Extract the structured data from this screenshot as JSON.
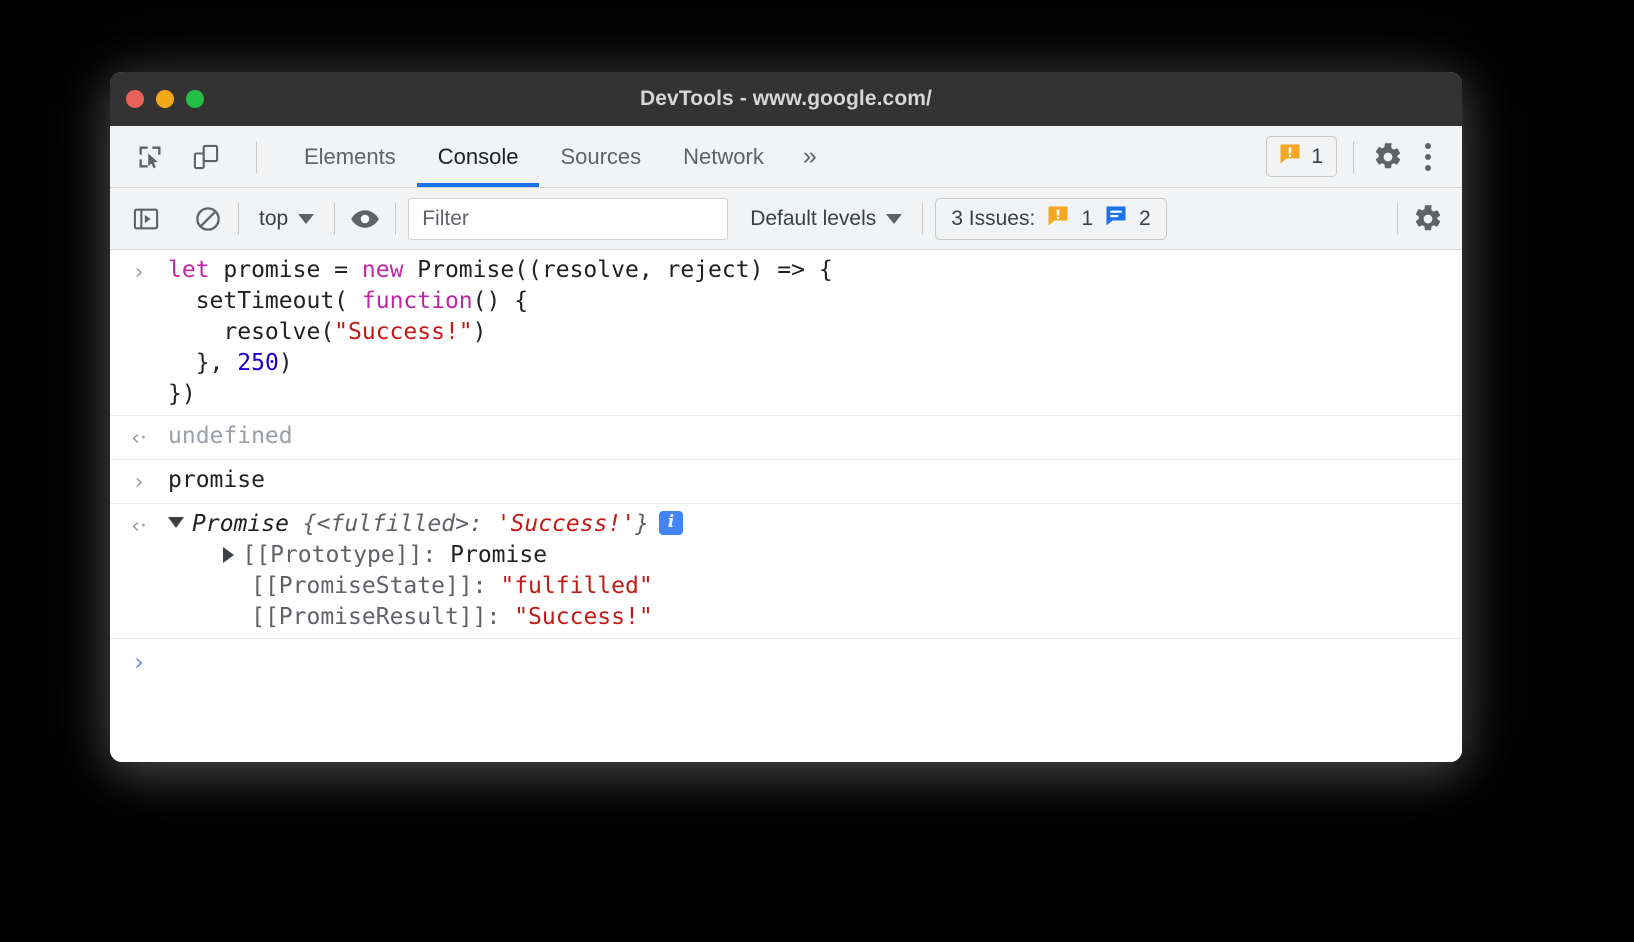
{
  "window": {
    "title": "DevTools - www.google.com/",
    "traffic_lights": [
      {
        "name": "close",
        "color": "#e8625c"
      },
      {
        "name": "minimize",
        "color": "#f3a817"
      },
      {
        "name": "zoom",
        "color": "#22bf44"
      }
    ]
  },
  "tabbar": {
    "inspect_icon": "inspect-element-icon",
    "device_icon": "device-toolbar-icon",
    "tabs": [
      {
        "label": "Elements",
        "active": false
      },
      {
        "label": "Console",
        "active": true
      },
      {
        "label": "Sources",
        "active": false
      },
      {
        "label": "Network",
        "active": false
      }
    ],
    "more_tabs_label": "»",
    "warning_badge": {
      "icon": "warning-icon",
      "count": "1"
    },
    "settings_icon": "gear-icon",
    "menu_icon": "kebab-menu-icon"
  },
  "console_toolbar": {
    "sidebar_icon": "console-sidebar-icon",
    "clear_icon": "clear-console-icon",
    "context": {
      "label": "top",
      "caret": "▼"
    },
    "eye_icon": "live-expression-icon",
    "filter": {
      "value": "",
      "placeholder": "Filter"
    },
    "levels": {
      "label": "Default levels",
      "caret": "▼"
    },
    "issues": {
      "label": "3 Issues:",
      "warning_count": "1",
      "info_count": "2"
    },
    "settings_icon": "console-settings-gear-icon"
  },
  "console": {
    "messages": [
      {
        "type": "input",
        "gutter": "›",
        "lines": [
          [
            {
              "t": "let",
              "c": "kw"
            },
            {
              "t": " promise = ",
              "c": "plain"
            },
            {
              "t": "new",
              "c": "kw"
            },
            {
              "t": " Promise((resolve, reject) => {",
              "c": "plain"
            }
          ],
          [
            {
              "t": "  setTimeout( ",
              "c": "plain"
            },
            {
              "t": "function",
              "c": "kw"
            },
            {
              "t": "() {",
              "c": "plain"
            }
          ],
          [
            {
              "t": "    resolve(",
              "c": "plain"
            },
            {
              "t": "\"Success!\"",
              "c": "str"
            },
            {
              "t": ")",
              "c": "plain"
            }
          ],
          [
            {
              "t": "  }, ",
              "c": "plain"
            },
            {
              "t": "250",
              "c": "num"
            },
            {
              "t": ")",
              "c": "plain"
            }
          ],
          [
            {
              "t": "})",
              "c": "plain"
            }
          ]
        ]
      },
      {
        "type": "output",
        "gutter": "‹·",
        "lines": [
          [
            {
              "t": "undefined",
              "c": "undef"
            }
          ]
        ]
      },
      {
        "type": "input",
        "gutter": "›",
        "lines": [
          [
            {
              "t": "promise",
              "c": "plain"
            }
          ]
        ]
      }
    ],
    "object_result": {
      "gutter": "‹·",
      "header": {
        "disclosure": "open",
        "constructor": "Promise",
        "brace_open": " {",
        "state": "<fulfilled>",
        "colon": ": ",
        "value": "'Success!'",
        "brace_close": "}",
        "info_badge": "i"
      },
      "properties": [
        {
          "disclosure": "closed",
          "key": "[[Prototype]]:",
          "value": "Promise",
          "value_kind": "plain"
        },
        {
          "disclosure": "none",
          "key": "[[PromiseState]]:",
          "value": "\"fulfilled\"",
          "value_kind": "string"
        },
        {
          "disclosure": "none",
          "key": "[[PromiseResult]]:",
          "value": "\"Success!\"",
          "value_kind": "string"
        }
      ]
    },
    "prompt": {
      "caret": "›",
      "value": ""
    }
  },
  "colors": {
    "accent": "#1a73e8",
    "warning": "#f5a623",
    "info": "#1a73e8",
    "string": "#c41a16",
    "keyword": "#c026a5",
    "number": "#1c00cf",
    "titlebar": "#333333",
    "toolbar": "#f1f3f4"
  }
}
